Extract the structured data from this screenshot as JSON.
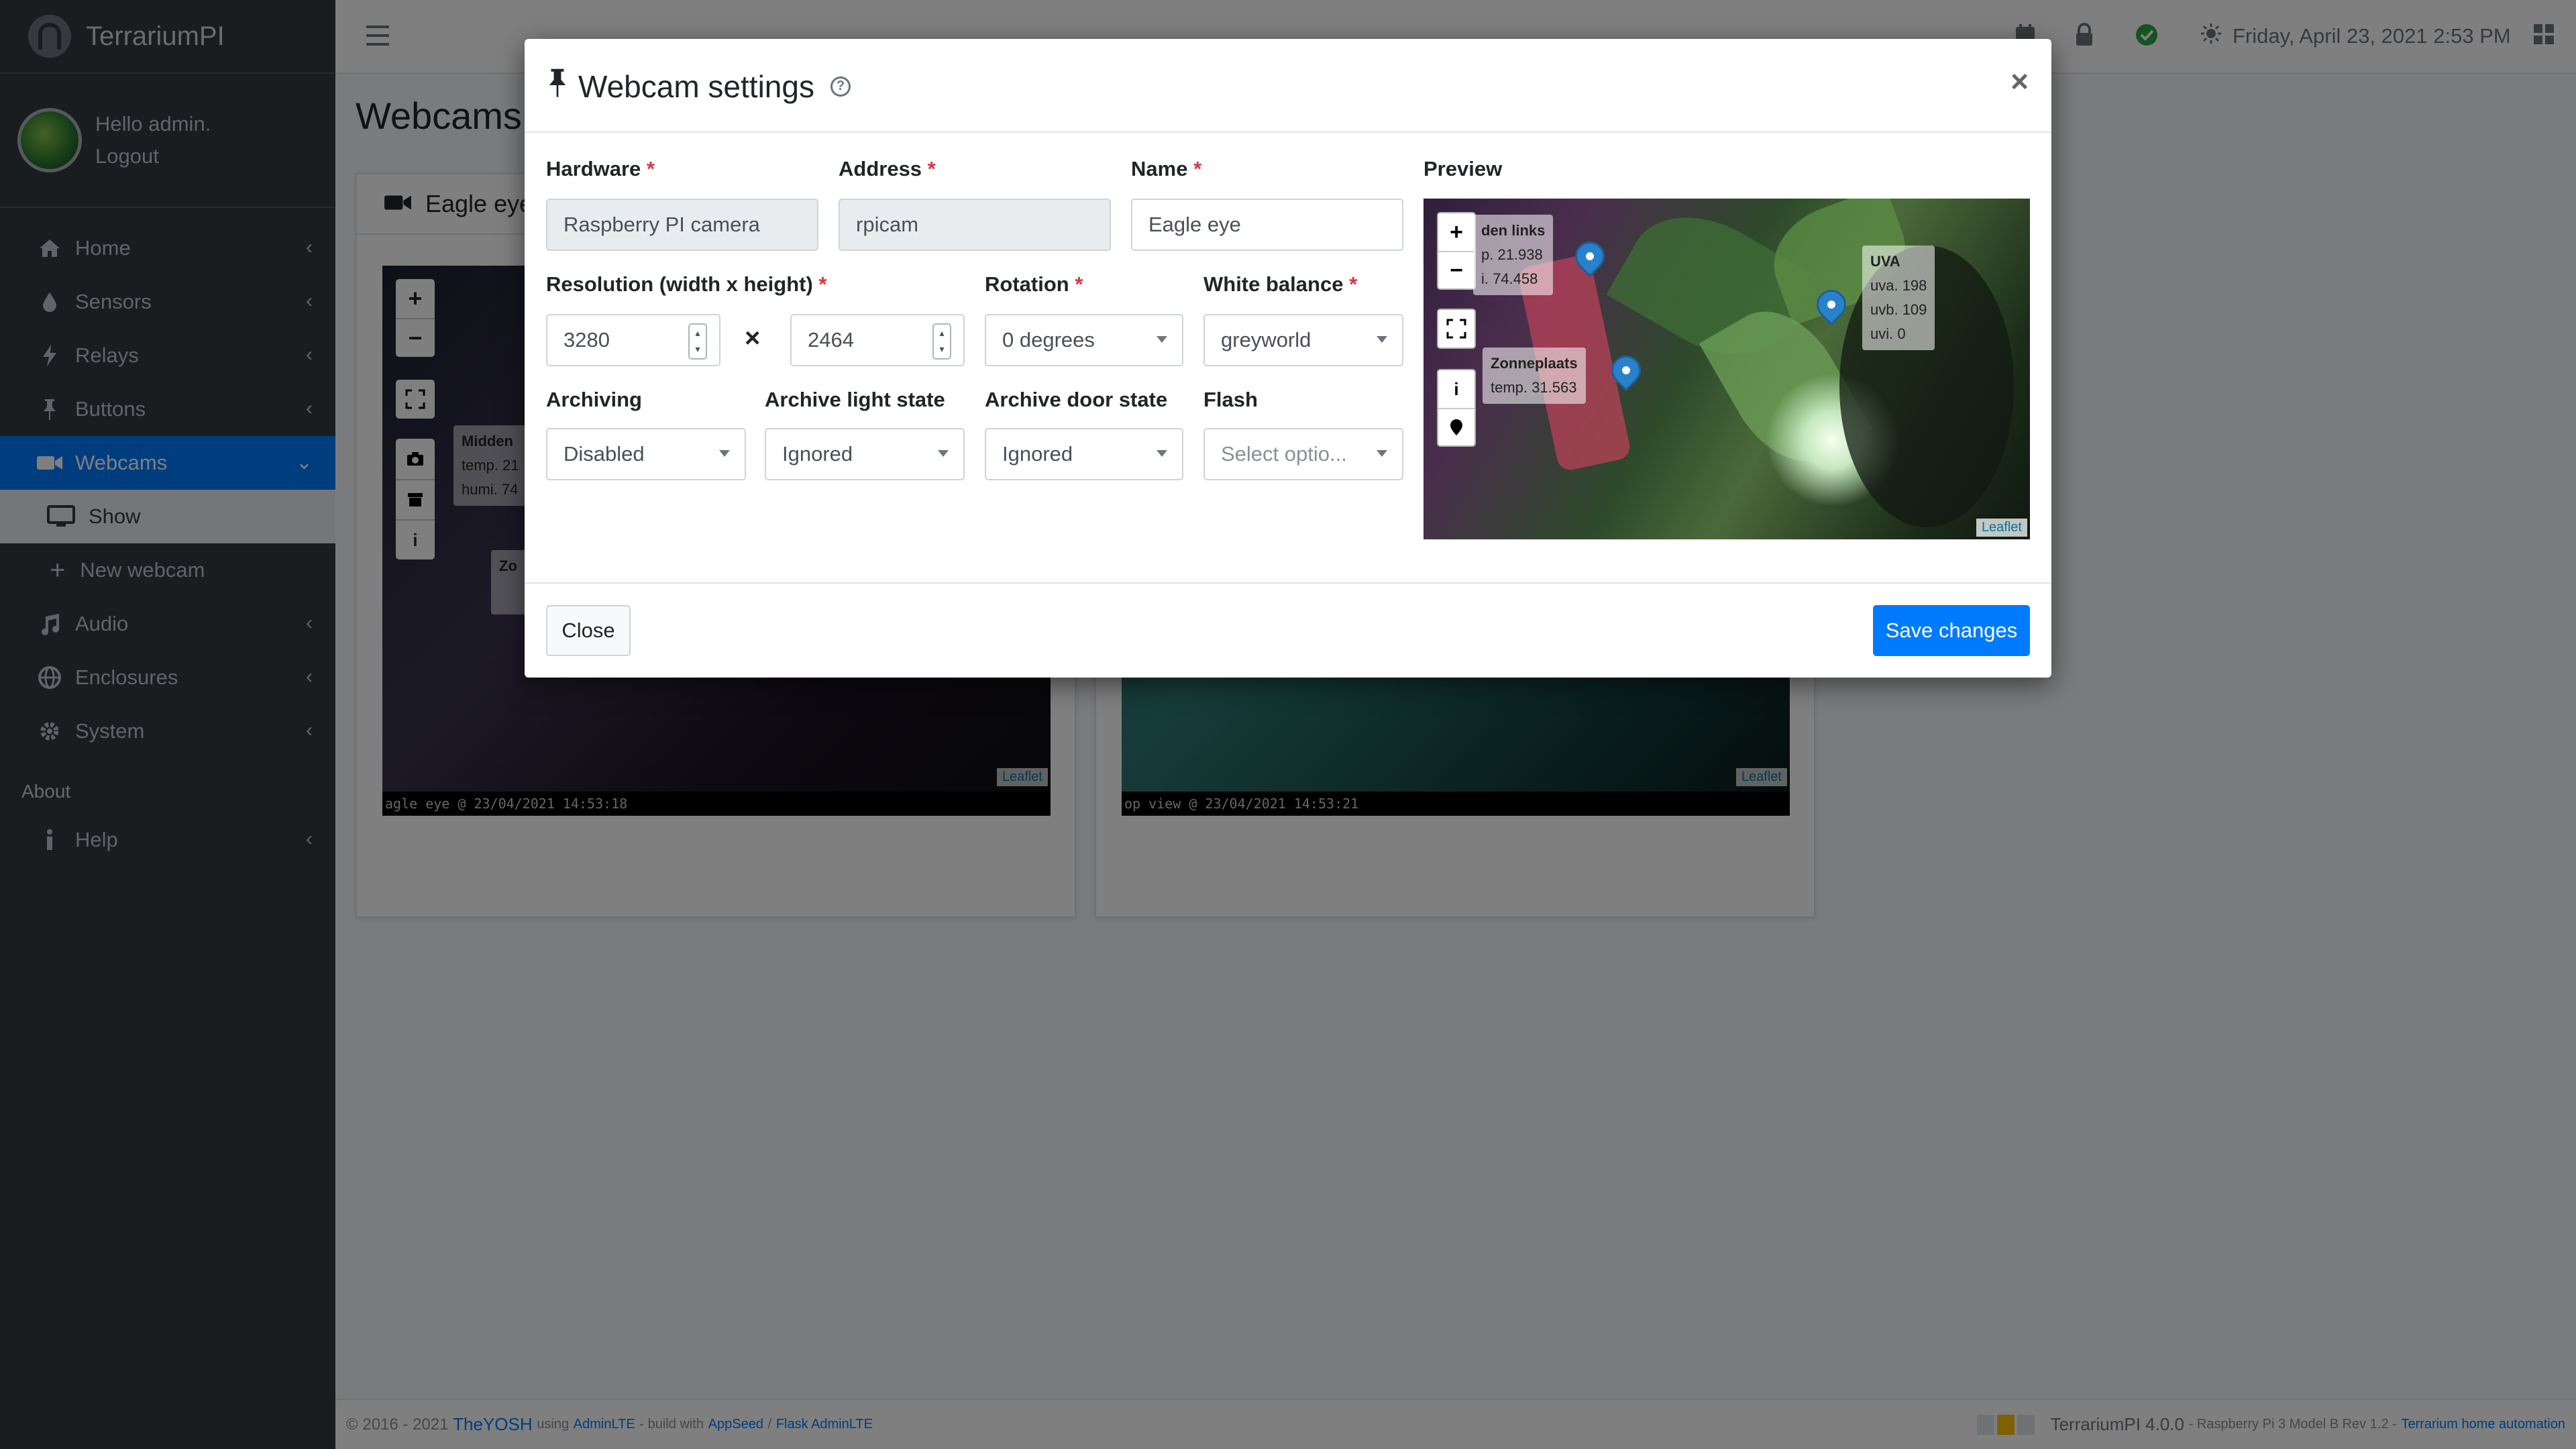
{
  "app": {
    "brand": "TerrariumPI"
  },
  "user": {
    "greeting": "Hello admin.",
    "logout": "Logout"
  },
  "sidebar": {
    "items": [
      {
        "label": "Home",
        "icon": "home-icon"
      },
      {
        "label": "Sensors",
        "icon": "tint-icon"
      },
      {
        "label": "Relays",
        "icon": "bolt-icon"
      },
      {
        "label": "Buttons",
        "icon": "thumbtack-icon"
      },
      {
        "label": "Webcams",
        "icon": "video-icon"
      },
      {
        "label": "Audio",
        "icon": "music-icon"
      },
      {
        "label": "Enclosures",
        "icon": "globe-icon"
      },
      {
        "label": "System",
        "icon": "gear-icon"
      },
      {
        "label": "Help",
        "icon": "info-icon"
      }
    ],
    "webcam_sub": [
      {
        "label": "Show"
      },
      {
        "label": "New webcam"
      }
    ],
    "section_about": "About"
  },
  "topbar": {
    "datetime": "Friday, April 23, 2021 2:53 PM"
  },
  "page": {
    "title": "Webcams",
    "cards": [
      {
        "title": "Eagle eye",
        "caption": "agle eye @ 23/04/2021 14:53:18",
        "tip1_title": "Midden",
        "tip1_line1": "temp. 21",
        "tip1_line2": "humi. 74",
        "tip2": "Zo"
      },
      {
        "title": "",
        "caption": "op view @ 23/04/2021 14:53:21"
      }
    ],
    "leaflet": "Leaflet"
  },
  "modal": {
    "title": "Webcam settings",
    "close_x": "×",
    "fields": {
      "hardware": {
        "label": "Hardware",
        "value": "Raspberry PI camera"
      },
      "address": {
        "label": "Address",
        "value": "rpicam"
      },
      "name": {
        "label": "Name",
        "value": "Eagle eye"
      },
      "resolution": {
        "label": "Resolution (width x height)",
        "width": "3280",
        "height": "2464",
        "separator": "×"
      },
      "rotation": {
        "label": "Rotation",
        "value": "0 degrees"
      },
      "white_balance": {
        "label": "White balance",
        "value": "greyworld"
      },
      "archiving": {
        "label": "Archiving",
        "value": "Disabled"
      },
      "archive_light": {
        "label": "Archive light state",
        "value": "Ignored"
      },
      "archive_door": {
        "label": "Archive door state",
        "value": "Ignored"
      },
      "flash": {
        "label": "Flash",
        "placeholder": "Select optio..."
      }
    },
    "required_mark": "*",
    "preview": {
      "label": "Preview",
      "tip1": {
        "title": "den links",
        "line1": "p. 21.938",
        "line2": "i. 74.458"
      },
      "tip2": {
        "title": "Zonneplaats",
        "line1": "temp. 31.563"
      },
      "tip3": {
        "title": "UVA",
        "line1": "uva. 198",
        "line2": "uvb. 109",
        "line3": "uvi. 0"
      },
      "attribution": "Leaflet"
    },
    "buttons": {
      "close": "Close",
      "save": "Save changes"
    }
  },
  "footer": {
    "copyright": "© 2016 - 2021",
    "author": "TheYOSH",
    "using": "using",
    "adminlte": "AdminLTE",
    "build": "- build with",
    "appseed": "AppSeed",
    "slash": "/",
    "flask": "Flask AdminLTE",
    "version": "TerrariumPI 4.0.0",
    "device": "- Raspberry Pi 3 Model B Rev 1.2 -",
    "tagline": "Terrarium home automation"
  },
  "colors": {
    "primary": "#007bff",
    "sidebar": "#343a40",
    "danger": "#dc3545"
  }
}
